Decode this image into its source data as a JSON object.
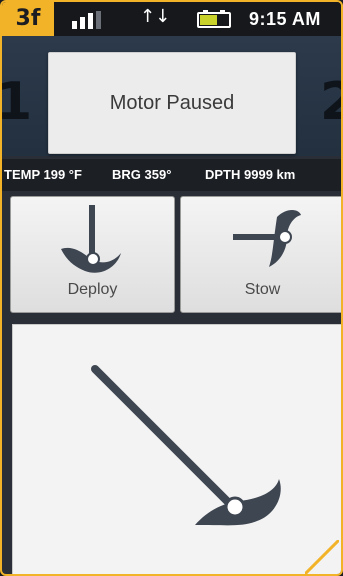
{
  "status_bar": {
    "mode_badge": "3f",
    "signal_icon": "signal-bars-icon",
    "sync_icon": "up-down-arrows-icon",
    "sync_text": "↑↓",
    "battery_icon": "battery-icon",
    "time": "9:15 AM"
  },
  "gauges": {
    "left_value": "1",
    "right_value": "2"
  },
  "toast": {
    "message": "Motor Paused"
  },
  "data_strip": {
    "temp": "TEMP 199 °F",
    "bearing": "BRG 359°",
    "depth": "DPTH 9999 km"
  },
  "buttons": {
    "deploy_label": "Deploy",
    "stow_label": "Stow"
  },
  "colors": {
    "accent": "#f2b329",
    "motor_gray": "#3e4652"
  }
}
